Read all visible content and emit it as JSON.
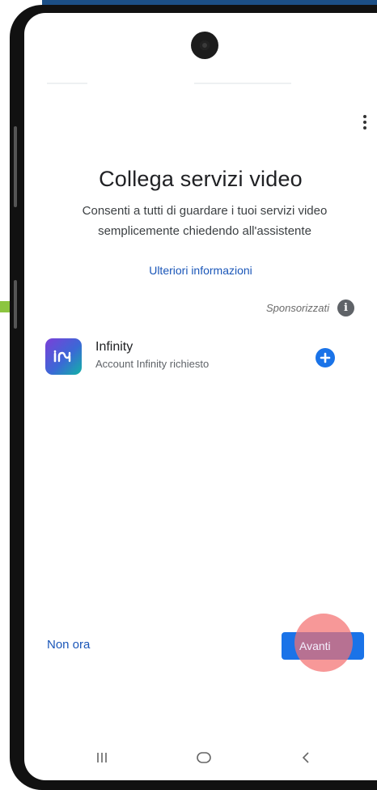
{
  "page": {
    "title": "Collega servizi video",
    "subtitle": "Consenti a tutti di guardare i tuoi servizi video semplicemente chiedendo all'assistente",
    "learn_more": "Ulteriori informazioni"
  },
  "sponsored": {
    "label": "Sponsorizzati",
    "icon": "info-icon"
  },
  "services": [
    {
      "name": "Infinity",
      "description": "Account Infinity richiesto",
      "icon": "infinity-logo",
      "action_icon": "add-circle-icon"
    }
  ],
  "actions": {
    "not_now": "Non ora",
    "next": "Avanti"
  },
  "navbar": {
    "recent_icon": "recent-apps-icon",
    "home_icon": "home-icon",
    "back_icon": "back-icon"
  },
  "colors": {
    "accent": "#1a73e8",
    "link": "#1a56b8",
    "tap_indicator": "#f47070"
  }
}
